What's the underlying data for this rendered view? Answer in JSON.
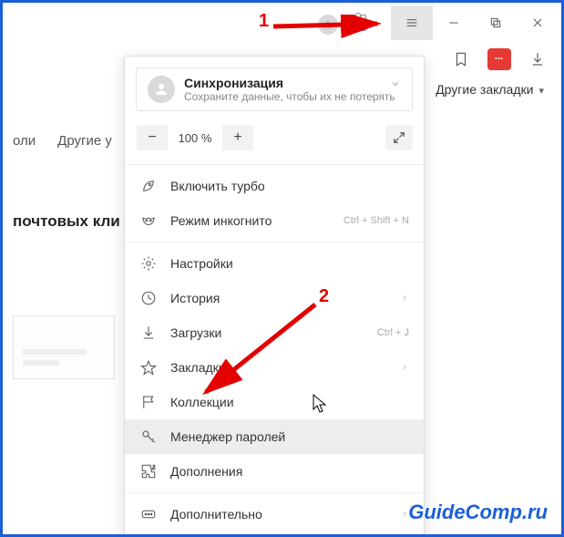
{
  "window": {
    "menu_button_active": true
  },
  "right_toolbar": {
    "bookmarks_folder_label": "Другие закладки"
  },
  "page_fragments": {
    "tab_oli": "оли",
    "tab_other": "Другие у",
    "section_title": "почтовых кли"
  },
  "menu": {
    "sync": {
      "title": "Синхронизация",
      "subtitle": "Сохраните данные, чтобы их не потерять"
    },
    "zoom": {
      "minus": "−",
      "value": "100 %",
      "plus": "+"
    },
    "items": {
      "turbo": {
        "label": "Включить турбо"
      },
      "incognito": {
        "label": "Режим инкогнито",
        "shortcut": "Ctrl + Shift + N"
      },
      "settings": {
        "label": "Настройки"
      },
      "history": {
        "label": "История"
      },
      "downloads": {
        "label": "Загрузки",
        "shortcut": "Ctrl + J"
      },
      "bookmarks": {
        "label": "Закладки"
      },
      "collections": {
        "label": "Коллекции"
      },
      "passwords": {
        "label": "Менеджер паролей"
      },
      "addons": {
        "label": "Дополнения"
      },
      "more": {
        "label": "Дополнительно"
      }
    }
  },
  "annotations": {
    "n1": "1",
    "n2": "2"
  },
  "watermark": "GuideComp.ru"
}
